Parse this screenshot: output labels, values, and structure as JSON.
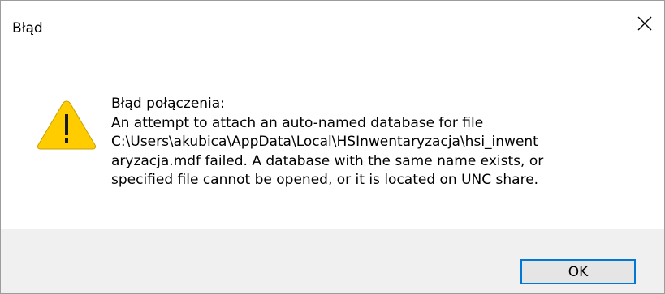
{
  "window": {
    "title": "Błąd"
  },
  "icons": {
    "close": "close-icon",
    "warning": "warning-icon"
  },
  "message": {
    "lines": [
      "Błąd połączenia:",
      "An attempt to attach an auto-named database for file",
      "C:\\Users\\akubica\\AppData\\Local\\HSInwentaryzacja\\hsi_inwent",
      "aryzacja.mdf failed. A database with the same name exists, or",
      "specified file cannot be opened, or it is located on UNC share."
    ]
  },
  "buttons": {
    "ok_label": "OK"
  },
  "colors": {
    "accent": "#0078d7",
    "warning_fill": "#ffcc00",
    "footer_bg": "#f0f0f0"
  }
}
